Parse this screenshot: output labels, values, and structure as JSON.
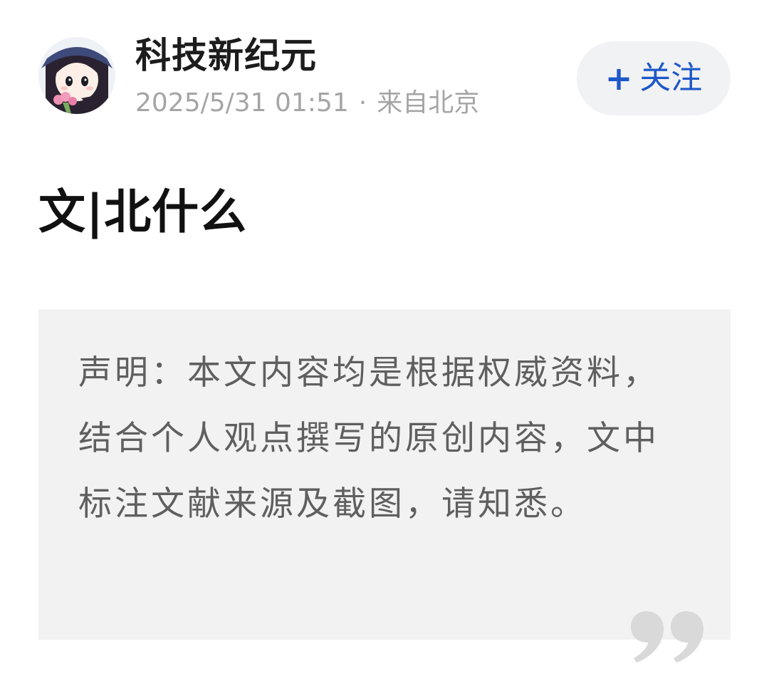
{
  "header": {
    "author_name": "科技新纪元",
    "timestamp": "2025/5/31 01:51",
    "separator": "·",
    "location": "来自北京",
    "follow_plus": "+",
    "follow_label": "关注"
  },
  "article": {
    "title": "文|北什么",
    "statement": "声明：本文内容均是根据权威资料，结合个人观点撰写的原创内容，文中标注文献来源及截图，请知悉。"
  },
  "colors": {
    "accent": "#1e58c8",
    "meta_text": "#a5a5a5",
    "quote_bg": "#f2f2f2",
    "quote_text": "#5f5f5f",
    "quote_mark": "#d9d9d9"
  },
  "icons": {
    "avatar": "cartoon-girl-avatar",
    "quote": "closing-quote-icon"
  }
}
